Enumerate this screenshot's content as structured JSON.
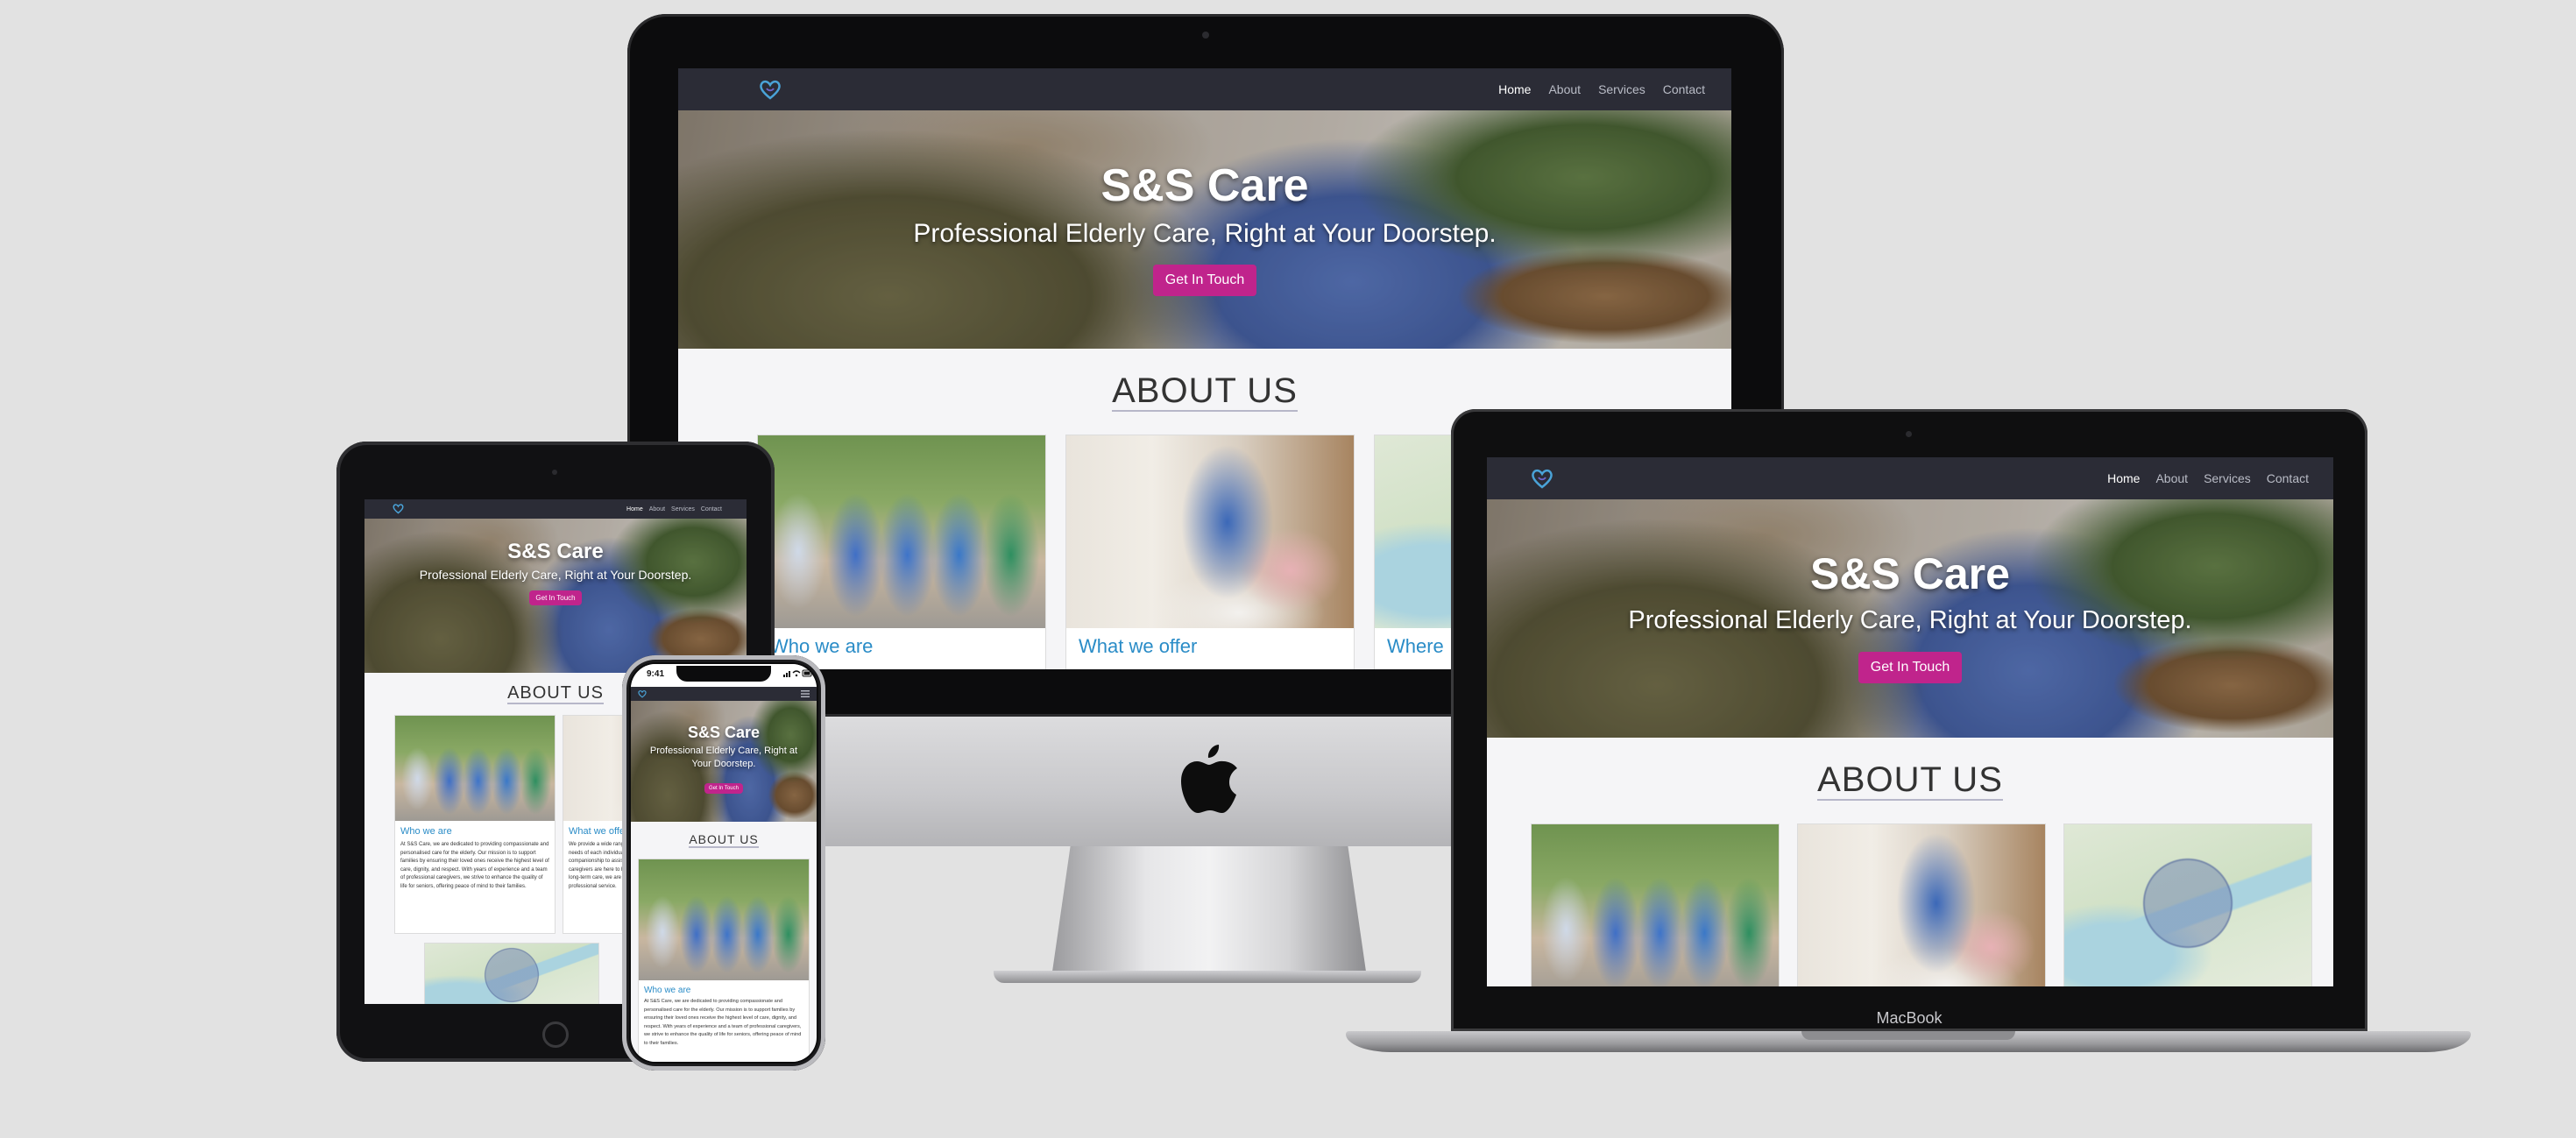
{
  "site": {
    "nav": {
      "items": [
        "Home",
        "About",
        "Services",
        "Contact"
      ],
      "active": "Home"
    },
    "hero": {
      "title": "S&S Care",
      "subtitle": "Professional Elderly Care, Right at Your Doorstep.",
      "button": "Get In Touch"
    },
    "about": {
      "title": "ABOUT US",
      "cards": [
        {
          "title": "Who we are",
          "text": "At S&S Care, we are dedicated to providing compassionate and personalised care for the elderly. Our mission is to support families by ensuring their loved ones receive the highest level of care, dignity, and respect. With years of experience and a team of professional caregivers, we strive to enhance the quality of life for seniors, offering peace of mind to their families.",
          "image": "team-photo"
        },
        {
          "title": "What we offer",
          "text": "We provide a wide range of services tailored to meet the unique needs of each individual, from personal care and companionship to assistance with medical conditions. Our caregivers are here to help. Whether it's short-term support or long-term care, we are committed to delivering compassionate, professional service.",
          "image": "caregiver-photo"
        },
        {
          "title": "Where",
          "text": "",
          "image": "map"
        }
      ]
    }
  },
  "devices": {
    "laptop_label": "MacBook",
    "phone_time": "9:41"
  },
  "colors": {
    "nav_bg": "#2b2c36",
    "accent_button": "#c0248c",
    "card_title": "#2a8cc7",
    "page_bg": "#e2e2e2"
  }
}
